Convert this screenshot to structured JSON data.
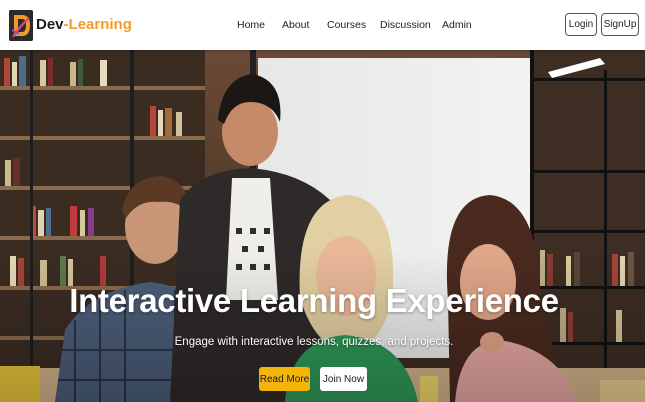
{
  "brand": {
    "name_part1": "Dev",
    "name_part2": "-Learning",
    "logo_icon": "dev-learning-logo",
    "accent_color": "#f39b2a"
  },
  "nav": {
    "links": [
      {
        "label": "Home"
      },
      {
        "label": "About"
      },
      {
        "label": "Courses"
      },
      {
        "label": "Discussion"
      },
      {
        "label": "Admin"
      }
    ],
    "login_label": "Login",
    "signup_label": "SignUp"
  },
  "hero": {
    "title": "Interactive Learning Experience",
    "subtitle": "Engage with interactive lessons, quizzes, and projects.",
    "read_more_label": "Read More",
    "join_now_label": "Join Now",
    "read_more_color": "#f5b40a"
  }
}
